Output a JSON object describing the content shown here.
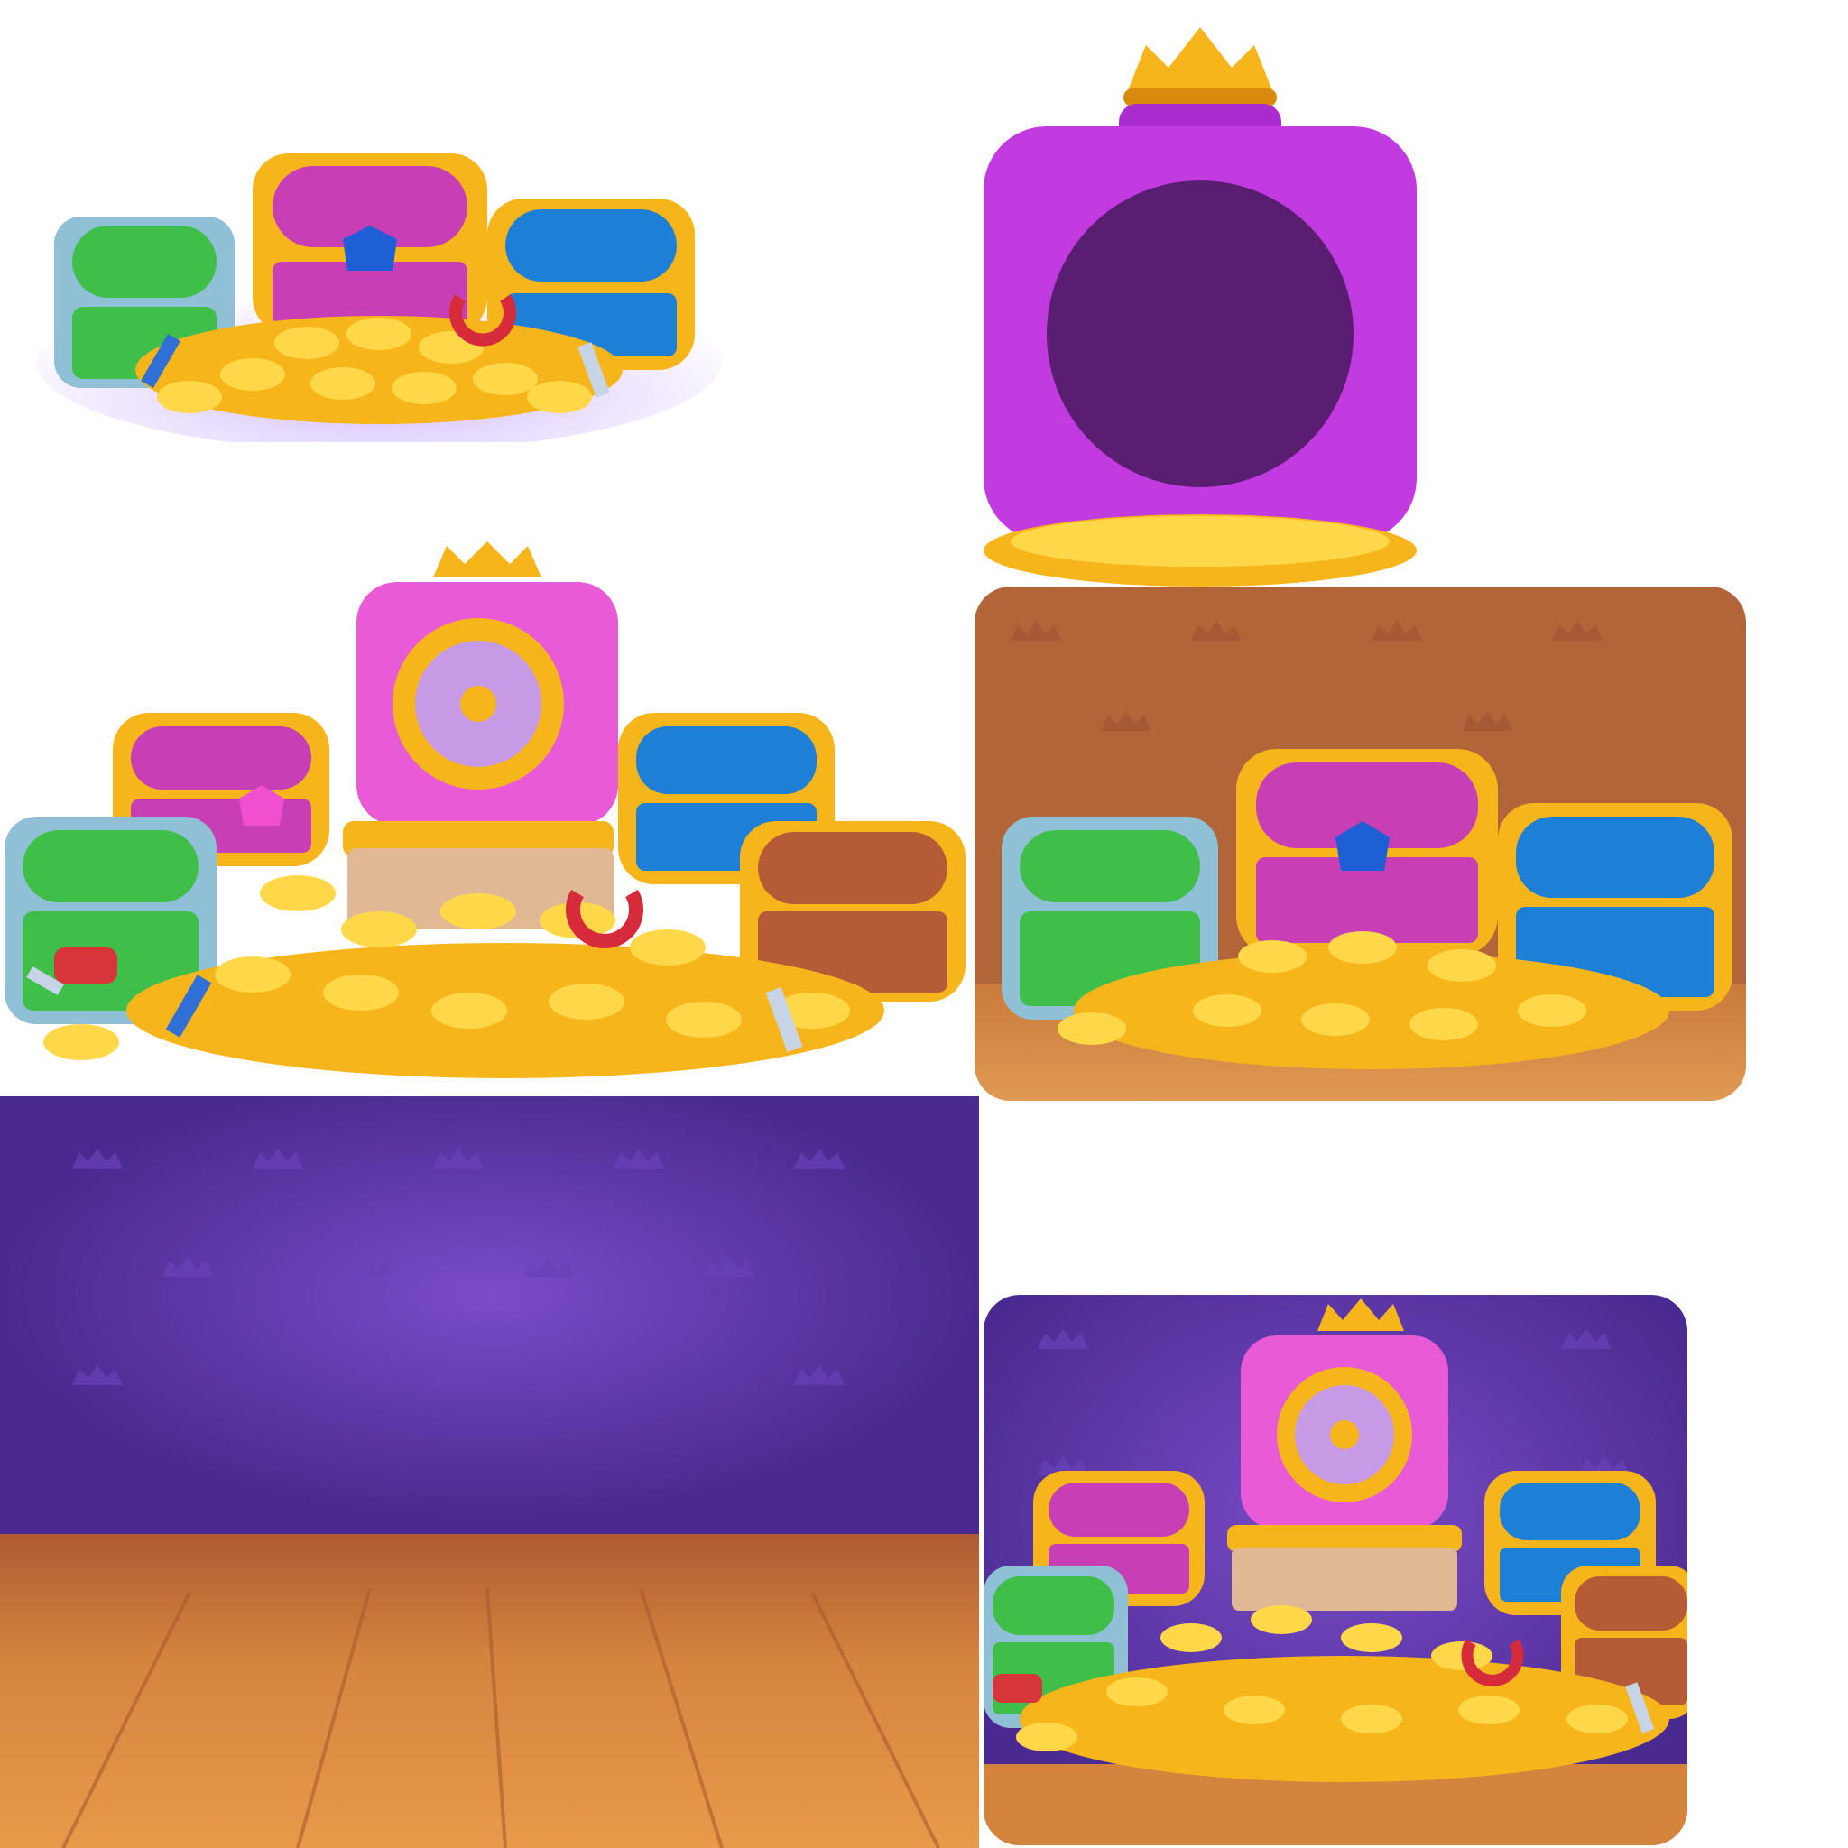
{
  "sheet": {
    "background": "#ffffff",
    "sprites": [
      {
        "name": "chest-trio-with-coins",
        "icons": [
          "green-chest-icon",
          "pink-chest-icon",
          "blue-chest-icon",
          "coin-pile-icon",
          "magnet-icon",
          "brush-icon",
          "hammer-icon"
        ]
      },
      {
        "name": "empty-safe-shell",
        "icons": [
          "crown-icon",
          "safe-body-icon",
          "safe-base-icon"
        ]
      },
      {
        "name": "treasure-cluster-transparent",
        "icons": [
          "safe-icon",
          "pink-chest-icon",
          "blue-chest-icon",
          "green-chest-icon",
          "brown-chest-icon",
          "coin-pile-icon",
          "drill-icon",
          "magnet-icon",
          "brush-icon",
          "hammer-icon"
        ]
      },
      {
        "name": "brown-room-panel",
        "icons": [
          "crown-pattern-icon",
          "wood-floor-icon",
          "chest-trio-icon"
        ]
      },
      {
        "name": "purple-room-background",
        "icons": [
          "crown-pattern-icon",
          "wood-floor-icon"
        ]
      },
      {
        "name": "purple-room-panel",
        "icons": [
          "crown-pattern-icon",
          "safe-icon",
          "treasure-cluster-icon"
        ]
      }
    ]
  },
  "colors": {
    "gold": "#f7b51c",
    "gold_light": "#ffd84a",
    "gold_dark": "#d98a0c",
    "pink": "#d14ad1",
    "safe_pink": "#e85ad6",
    "purple_safe": "#c23be0",
    "blue": "#1e7fd6",
    "green": "#3fbf49",
    "steel": "#8fc0d6",
    "brown_chest": "#b55b35",
    "room_brown": "#b3653a",
    "room_purple": "#5c36a6",
    "wood": "#d98a3a"
  }
}
